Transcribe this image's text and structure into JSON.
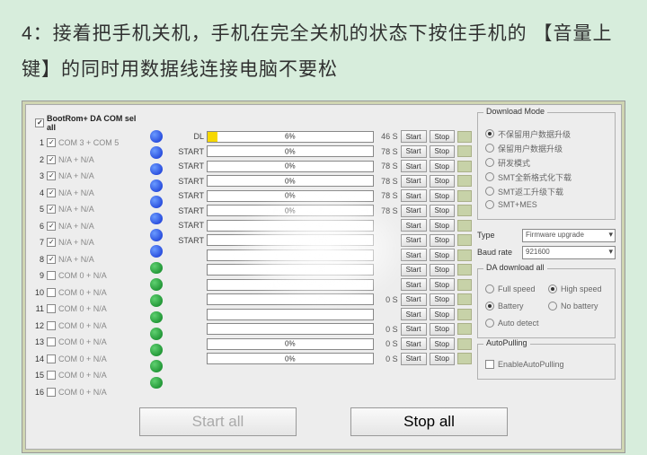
{
  "instruction": "4：接着把手机关机，手机在完全关机的状态下按住手机的 【音量上键】的同时用数据线连接电脑不要松",
  "select_all_label": "BootRom+ DA COM sel all",
  "rows": [
    {
      "idx": "1",
      "chk": true,
      "label": "COM 3 + COM 5",
      "color": "blue",
      "start": "DL",
      "pct": "6%",
      "fill": 6,
      "sec": "46 S"
    },
    {
      "idx": "2",
      "chk": true,
      "label": "N/A + N/A",
      "color": "blue",
      "start": "START",
      "pct": "0%",
      "fill": 0,
      "sec": "78 S"
    },
    {
      "idx": "3",
      "chk": true,
      "label": "N/A + N/A",
      "color": "blue",
      "start": "START",
      "pct": "0%",
      "fill": 0,
      "sec": "78 S"
    },
    {
      "idx": "4",
      "chk": true,
      "label": "N/A + N/A",
      "color": "blue",
      "start": "START",
      "pct": "0%",
      "fill": 0,
      "sec": "78 S"
    },
    {
      "idx": "5",
      "chk": true,
      "label": "N/A + N/A",
      "color": "blue",
      "start": "START",
      "pct": "0%",
      "fill": 0,
      "sec": "78 S"
    },
    {
      "idx": "6",
      "chk": true,
      "label": "N/A + N/A",
      "color": "blue",
      "start": "START",
      "pct": "0%",
      "fill": 0,
      "sec": "78 S"
    },
    {
      "idx": "7",
      "chk": true,
      "label": "N/A + N/A",
      "color": "blue",
      "start": "START",
      "pct": "",
      "fill": 0,
      "sec": ""
    },
    {
      "idx": "8",
      "chk": true,
      "label": "N/A + N/A",
      "color": "blue",
      "start": "START",
      "pct": "",
      "fill": 0,
      "sec": ""
    },
    {
      "idx": "9",
      "chk": false,
      "label": "COM 0 + N/A",
      "color": "green",
      "start": "",
      "pct": "",
      "fill": 0,
      "sec": ""
    },
    {
      "idx": "10",
      "chk": false,
      "label": "COM 0 + N/A",
      "color": "green",
      "start": "",
      "pct": "",
      "fill": 0,
      "sec": ""
    },
    {
      "idx": "11",
      "chk": false,
      "label": "COM 0 + N/A",
      "color": "green",
      "start": "",
      "pct": "",
      "fill": 0,
      "sec": ""
    },
    {
      "idx": "12",
      "chk": false,
      "label": "COM 0 + N/A",
      "color": "green",
      "start": "",
      "pct": "",
      "fill": 0,
      "sec": "0 S"
    },
    {
      "idx": "13",
      "chk": false,
      "label": "COM 0 + N/A",
      "color": "green",
      "start": "",
      "pct": "",
      "fill": 0,
      "sec": ""
    },
    {
      "idx": "14",
      "chk": false,
      "label": "COM 0 + N/A",
      "color": "green",
      "start": "",
      "pct": "",
      "fill": 0,
      "sec": "0 S"
    },
    {
      "idx": "15",
      "chk": false,
      "label": "COM 0 + N/A",
      "color": "green",
      "start": "",
      "pct": "0%",
      "fill": 0,
      "sec": "0 S"
    },
    {
      "idx": "16",
      "chk": false,
      "label": "COM 0 + N/A",
      "color": "green",
      "start": "",
      "pct": "0%",
      "fill": 0,
      "sec": "0 S"
    }
  ],
  "row_buttons": {
    "start": "Start",
    "stop": "Stop"
  },
  "download_mode": {
    "title": "Download Mode",
    "options": [
      "不保留用户数据升级",
      "保留用户数据升级",
      "研发模式",
      "SMT全新格式化下载",
      "SMT返工升级下载",
      "SMT+MES"
    ],
    "selected": 0
  },
  "type_section": {
    "type_label": "Type",
    "type_value": "Firmware upgrade",
    "baud_label": "Baud rate",
    "baud_value": "921600"
  },
  "da_download": {
    "title": "DA download all",
    "options": [
      "Full speed",
      "High speed",
      "Battery",
      "No battery",
      "Auto detect"
    ],
    "selected_row1": 1,
    "selected_row2": 0
  },
  "autopulling": {
    "title": "AutoPulling",
    "label": "EnableAutoPulling"
  },
  "main_buttons": {
    "start_all": "Start all",
    "stop_all": "Stop all"
  }
}
